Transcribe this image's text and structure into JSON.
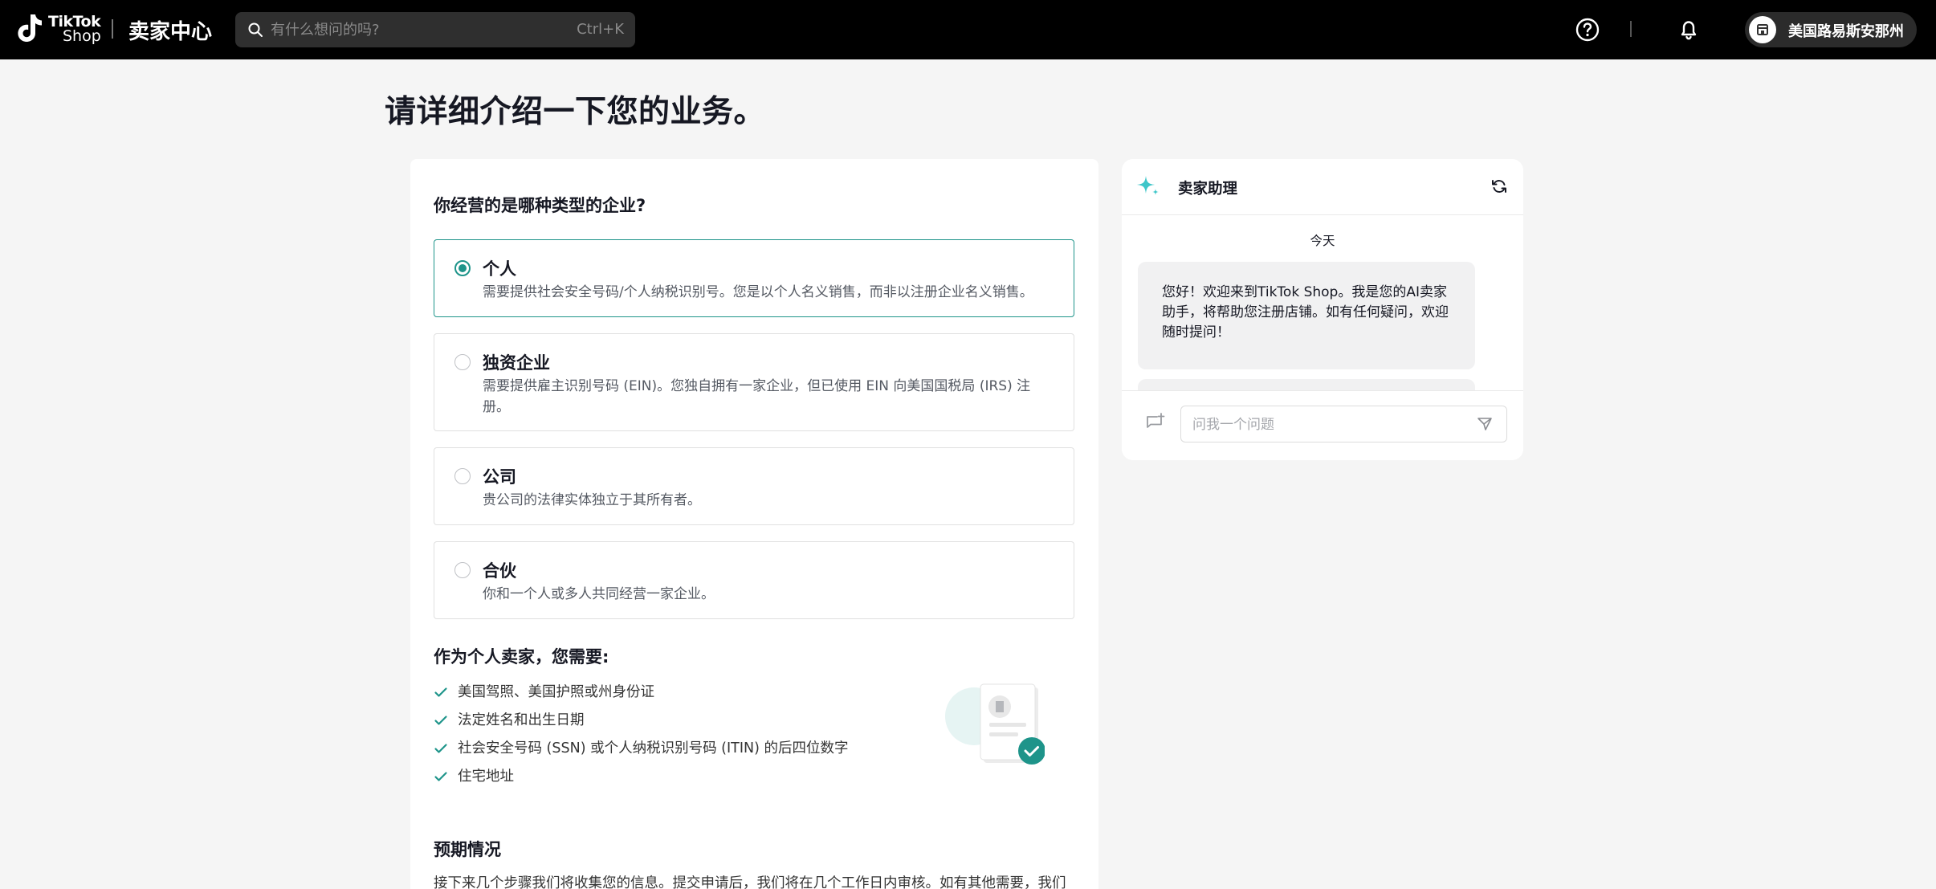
{
  "header": {
    "logo_line1": "TikTok",
    "logo_line2": "Shop",
    "center_title": "卖家中心",
    "search_placeholder": "有什么想问的吗?",
    "search_shortcut": "Ctrl+K",
    "account_name": "美国路易斯安那州"
  },
  "page": {
    "title": "请详细介绍一下您的业务。"
  },
  "business": {
    "question": "你经营的是哪种类型的企业?",
    "options": [
      {
        "title": "个人",
        "desc": "需要提供社会安全号码/个人纳税识别号。您是以个人名义销售，而非以注册企业名义销售。",
        "selected": true
      },
      {
        "title": "独资企业",
        "desc": "需要提供雇主识别号码 (EIN)。您独自拥有一家企业，但已使用 EIN 向美国国税局 (IRS) 注册。",
        "selected": false
      },
      {
        "title": "公司",
        "desc": "贵公司的法律实体独立于其所有者。",
        "selected": false
      },
      {
        "title": "合伙",
        "desc": "你和一个人或多人共同经营一家企业。",
        "selected": false
      }
    ],
    "requirements_title": "作为个人卖家，您需要:",
    "requirements": [
      "美国驾照、美国护照或州身份证",
      "法定姓名和出生日期",
      "社会安全号码 (SSN) 或个人纳税识别号码 (ITIN) 的后四位数字",
      "住宅地址"
    ],
    "expect_title": "预期情况",
    "expect_text": "接下来几个步骤我们将收集您的信息。提交申请后，我们将在几个工作日内审核。如有其他需要，我们"
  },
  "assistant": {
    "title": "卖家助理",
    "date_label": "今天",
    "message": "您好！欢迎来到TikTok Shop。我是您的AI卖家助手，将帮助您注册店铺。如有任何疑问，欢迎随时提问！",
    "input_placeholder": "问我一个问题"
  },
  "colors": {
    "accent": "#1e948a",
    "header_bg": "#000000",
    "page_bg": "#f5f5f5"
  },
  "icons": [
    "tiktok-logo-icon",
    "search-icon",
    "help-icon",
    "bell-icon",
    "store-icon",
    "sparkle-icon",
    "refresh-icon",
    "check-icon",
    "document-illustration",
    "chat-add-icon",
    "send-icon"
  ]
}
